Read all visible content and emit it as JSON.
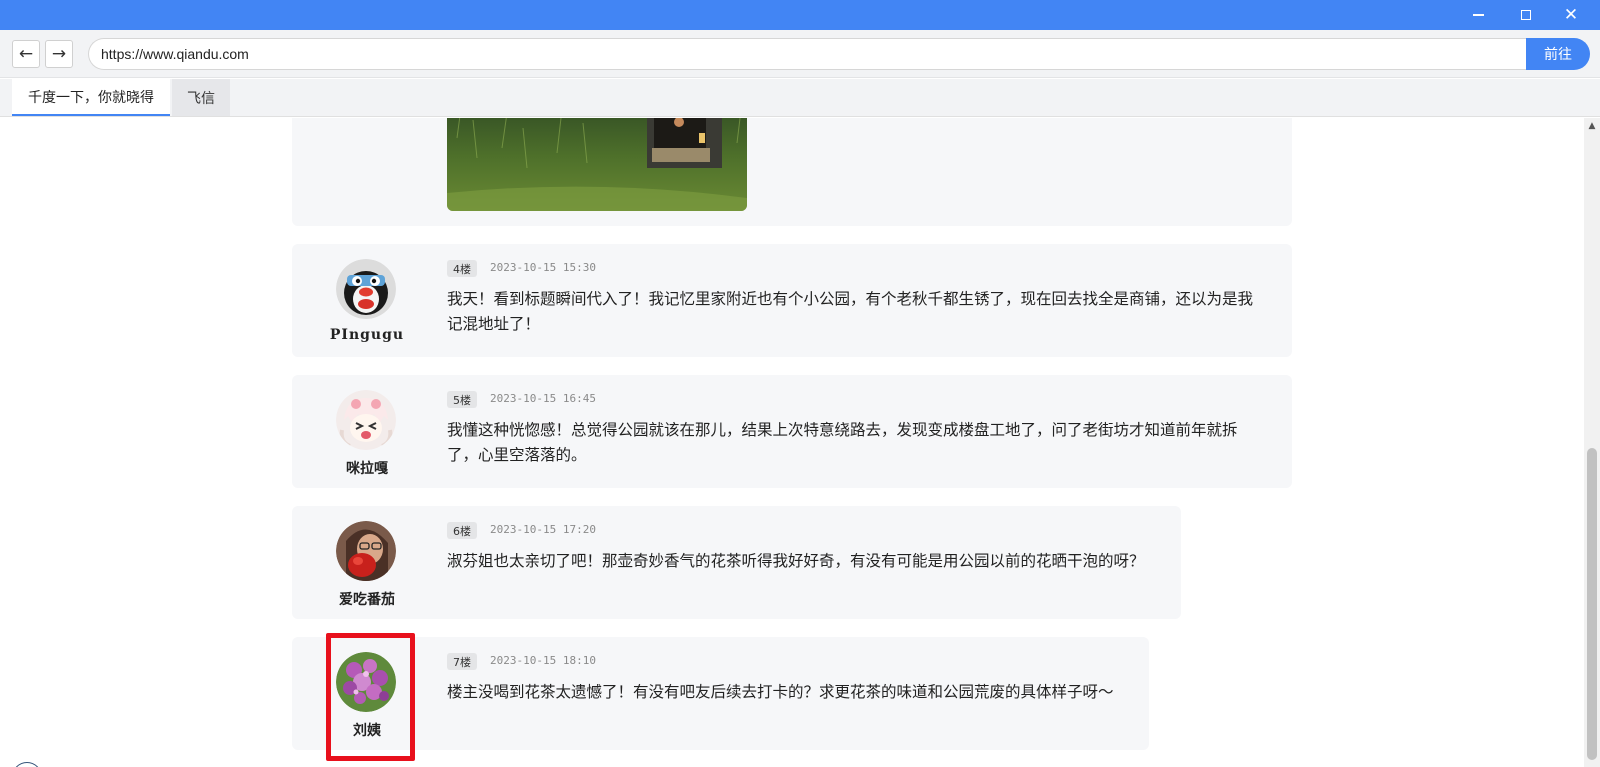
{
  "window": {
    "minimize_icon": "minimize-icon",
    "maximize_icon": "maximize-icon",
    "close_glyph": "✕"
  },
  "nav": {
    "back": "←",
    "forward": "→",
    "url": "https://www.qiandu.com",
    "go_label": "前往"
  },
  "tabs": [
    {
      "label": "千度一下，你就晓得",
      "active": true
    },
    {
      "label": "飞信",
      "active": false
    }
  ],
  "posts": [
    {
      "floor": "4楼",
      "time": "2023-10-15 15:30",
      "username": "PIngugu",
      "avatar": "penguin-avatar",
      "content": "我天！看到标题瞬间代入了！我记忆里家附近也有个小公园，有个老秋千都生锈了，现在回去找全是商铺，还以为是我记混地址了！"
    },
    {
      "floor": "5楼",
      "time": "2023-10-15 16:45",
      "username": "咪拉嘎",
      "avatar": "anime-girl-avatar",
      "content": "我懂这种恍惚感！总觉得公园就该在那儿，结果上次特意绕路去，发现变成楼盘工地了，问了老街坊才知道前年就拆了，心里空落落的。"
    },
    {
      "floor": "6楼",
      "time": "2023-10-15 17:20",
      "username": "爱吃番茄",
      "avatar": "person-avatar",
      "content": "淑芬姐也太亲切了吧！那壶奇妙香气的花茶听得我好好奇，有没有可能是用公园以前的花晒干泡的呀？"
    },
    {
      "floor": "7楼",
      "time": "2023-10-15 18:10",
      "username": "刘姨",
      "avatar": "flowers-avatar",
      "content": "楼主没喝到花茶太遗憾了！有没有吧友后续去打卡的？求更花茶的味道和公园荒废的具体样子呀～"
    }
  ],
  "scrollbar": {
    "up_arrow": "▲"
  },
  "colors": {
    "accent": "#4285f4",
    "highlight": "#e8101c",
    "card_bg": "#f6f7f9"
  }
}
